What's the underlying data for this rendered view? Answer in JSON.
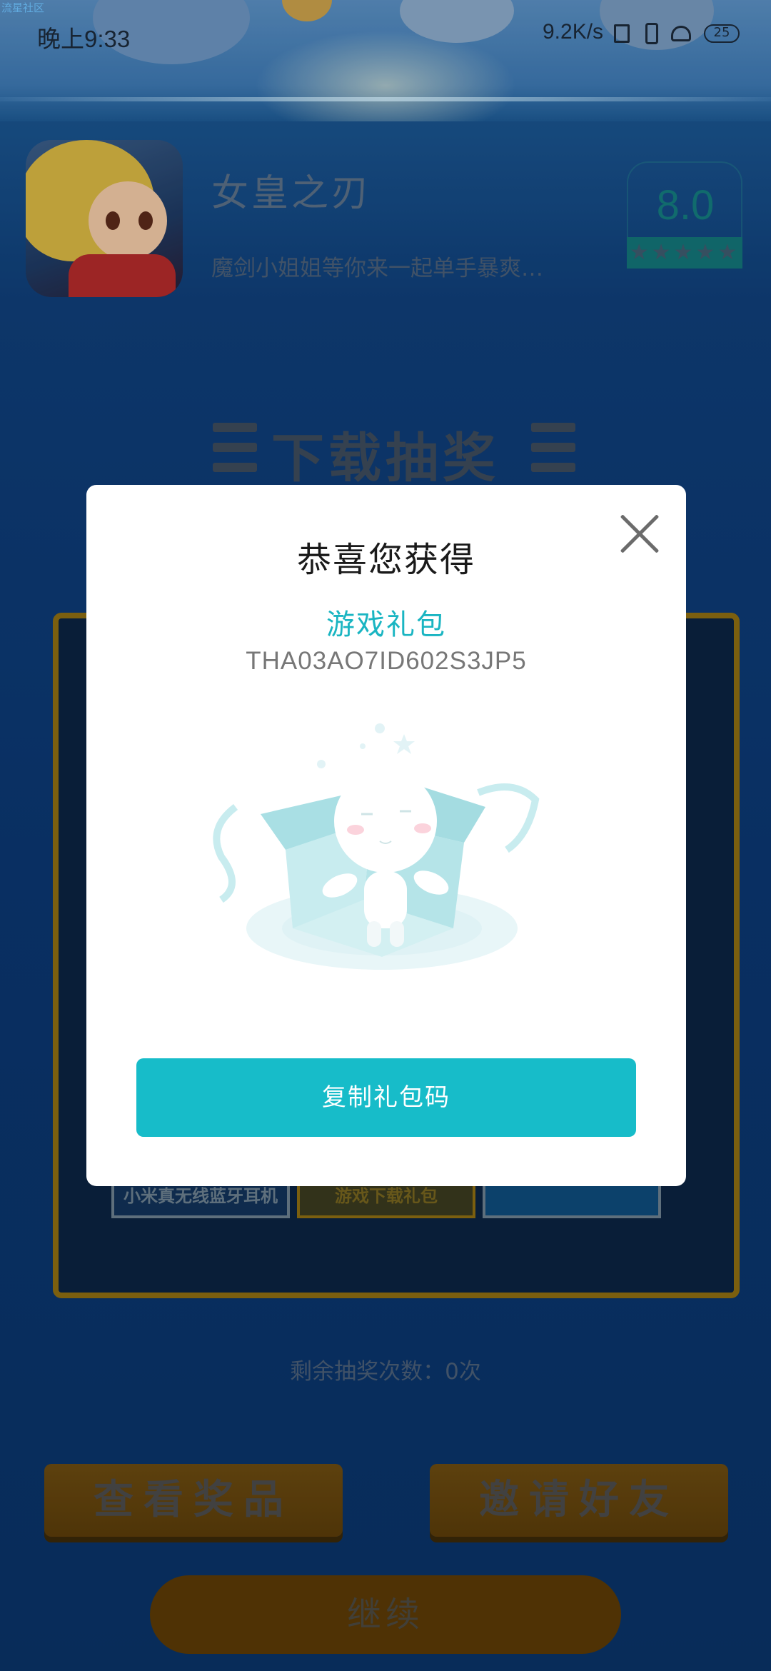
{
  "status_bar": {
    "overlay_label": "流星社区",
    "time": "晚上9:33",
    "network_speed": "9.2K/s",
    "battery": "25"
  },
  "game": {
    "title": "女皇之刃",
    "description": "魔剑小姐姐等你来一起单手暴爽…",
    "rating": "8.0",
    "stars": "★★★★★"
  },
  "lottery": {
    "heading": "下载抽奖",
    "prizes": [
      "小米真无线蓝牙耳机",
      "游戏下载礼包",
      ""
    ],
    "remaining_text": "剩余抽奖次数：0次"
  },
  "buttons": {
    "view_prizes": "查看奖品",
    "invite_friends": "邀请好友",
    "continue": "继续"
  },
  "dialog": {
    "title": "恭喜您获得",
    "prize_name": "游戏礼包",
    "code": "THA03AO7ID602S3JP5",
    "copy_button": "复制礼包码"
  },
  "colors": {
    "accent": "#17bcc9",
    "background": "#0b3670",
    "gold_border": "#8c6d12"
  }
}
